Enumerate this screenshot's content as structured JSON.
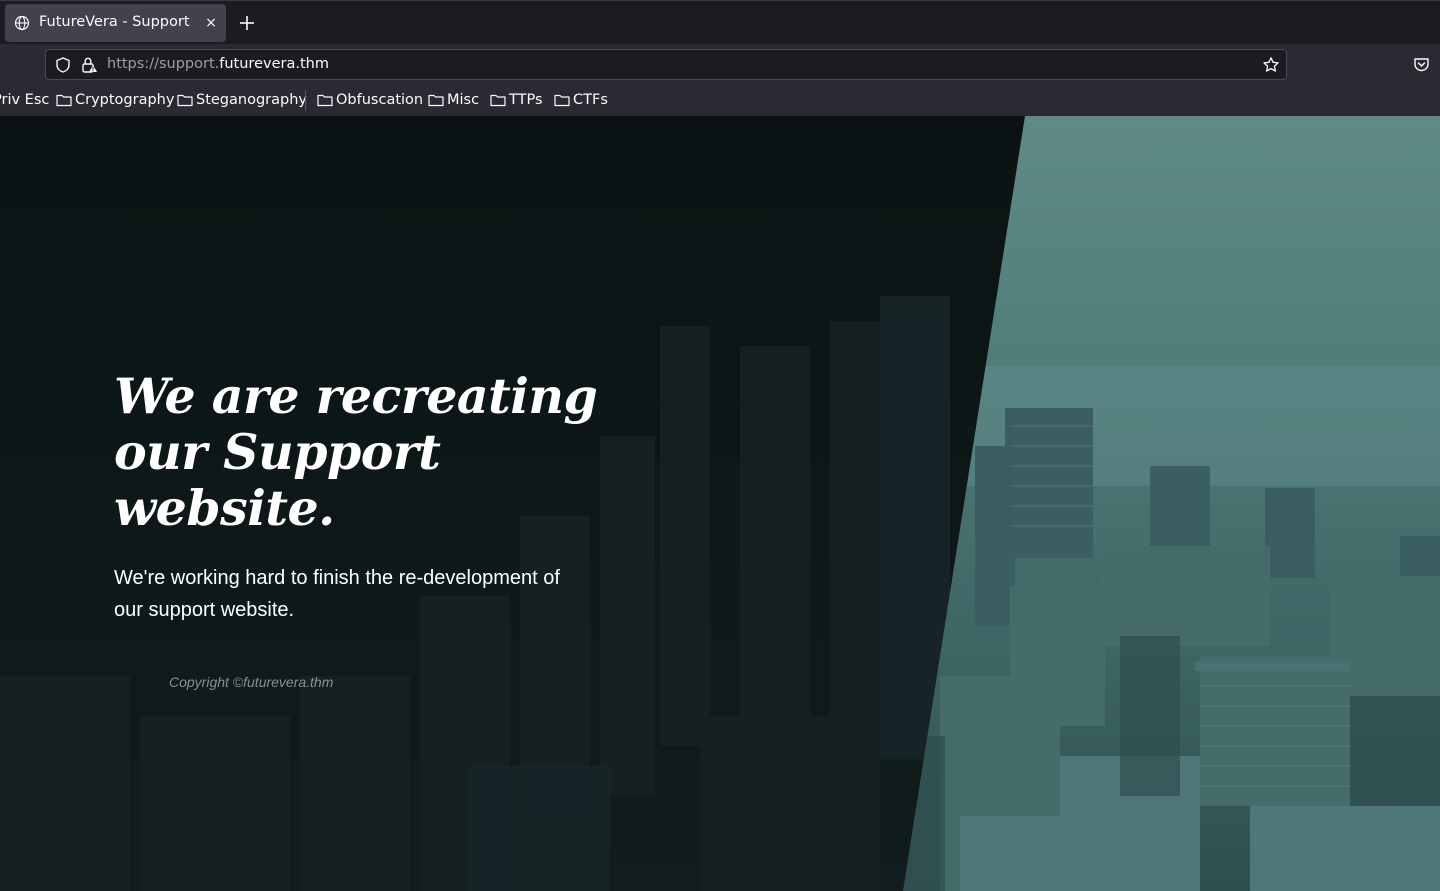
{
  "browser": {
    "tab_title": "FutureVera - Support",
    "tab_close": "×",
    "url_scheme": "https://support.",
    "url_domain": "futurevera.thm",
    "bookmarks": [
      {
        "label": "Priv Esc"
      },
      {
        "label": "Cryptography"
      },
      {
        "label": "Steganography"
      },
      {
        "label": "Obfuscation"
      },
      {
        "label": "Misc"
      },
      {
        "label": "TTPs"
      },
      {
        "label": "CTFs"
      }
    ]
  },
  "page": {
    "heading": "We are recreating our Support website.",
    "subtitle": "We're working hard to finish the re-development of our support website.",
    "copyright": "Copyright ©futurevera.thm"
  },
  "colors": {
    "chrome_dark": "#1c1b22",
    "chrome_toolbar": "#2b2a33",
    "tab_active": "#42414d",
    "page_dark": "#0c1415",
    "city_teal": "#3e6b6a"
  }
}
